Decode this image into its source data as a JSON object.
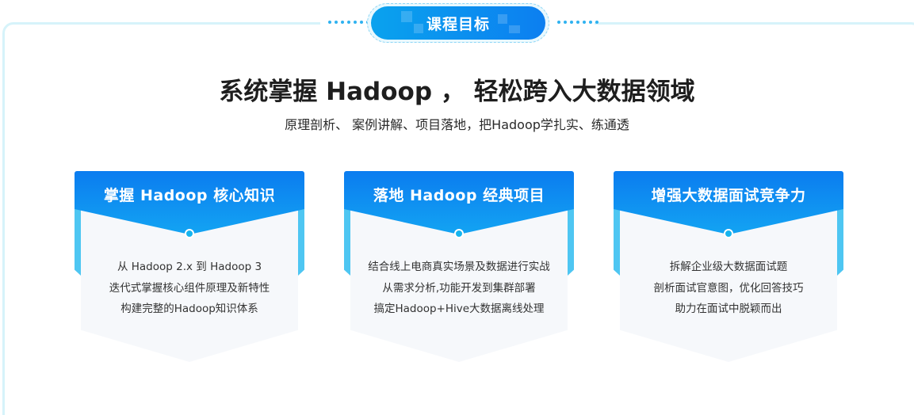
{
  "badge": {
    "label": "课程目标"
  },
  "heading": {
    "title": "系统掌握 Hadoop ， 轻松跨入大数据领域",
    "subtitle": "原理剖析、 案例讲解、项目落地，把Hadoop学扎实、练通透"
  },
  "cards": [
    {
      "title": "掌握 Hadoop 核心知识",
      "lines": [
        "从 Hadoop 2.x 到 Hadoop 3",
        "迭代式掌握核心组件原理及新特性",
        "构建完整的Hadoop知识体系"
      ]
    },
    {
      "title": "落地 Hadoop 经典项目",
      "lines": [
        "结合线上电商真实场景及数据进行实战",
        "从需求分析,功能开发到集群部署",
        "搞定Hadoop+Hive大数据离线处理"
      ]
    },
    {
      "title": "增强大数据面试竞争力",
      "lines": [
        "拆解企业级大数据面试题",
        "剖析面试官意图，优化回答技巧",
        "助力在面试中脱颖而出"
      ]
    }
  ],
  "colors": {
    "accent": "#0c8ff0",
    "accent_light": "#4ec6f2",
    "frame": "#d6f3fa",
    "card_body": "#f6f8fb"
  }
}
